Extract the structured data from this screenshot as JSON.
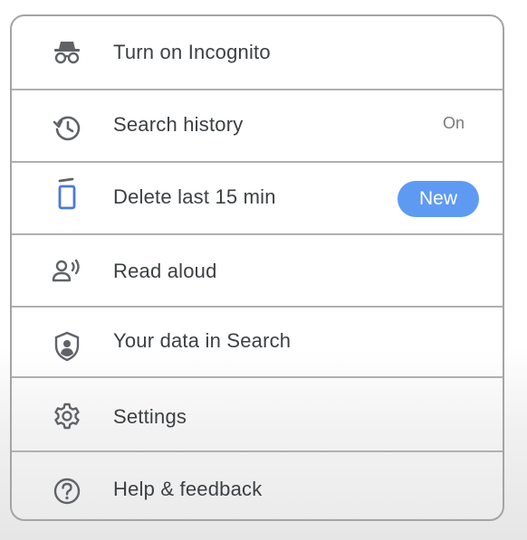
{
  "menu": {
    "items": [
      {
        "id": "incognito",
        "label": "Turn on Incognito",
        "icon": "incognito-icon"
      },
      {
        "id": "search-history",
        "label": "Search history",
        "icon": "history-icon",
        "status": "On"
      },
      {
        "id": "delete-last-15",
        "label": "Delete last 15 min",
        "icon": "trash-icon",
        "badge": "New"
      },
      {
        "id": "read-aloud",
        "label": "Read aloud",
        "icon": "read-aloud-icon"
      },
      {
        "id": "your-data",
        "label": "Your data in Search",
        "icon": "shield-account-icon"
      },
      {
        "id": "settings",
        "label": "Settings",
        "icon": "gear-icon"
      },
      {
        "id": "help",
        "label": "Help & feedback",
        "icon": "help-circle-icon"
      }
    ]
  },
  "colors": {
    "badge_background": "#5f9af2",
    "text": "#3c4043",
    "divider": "#b0b0b0",
    "icon": "#5f6368",
    "trash_icon": "#4a79d6"
  }
}
